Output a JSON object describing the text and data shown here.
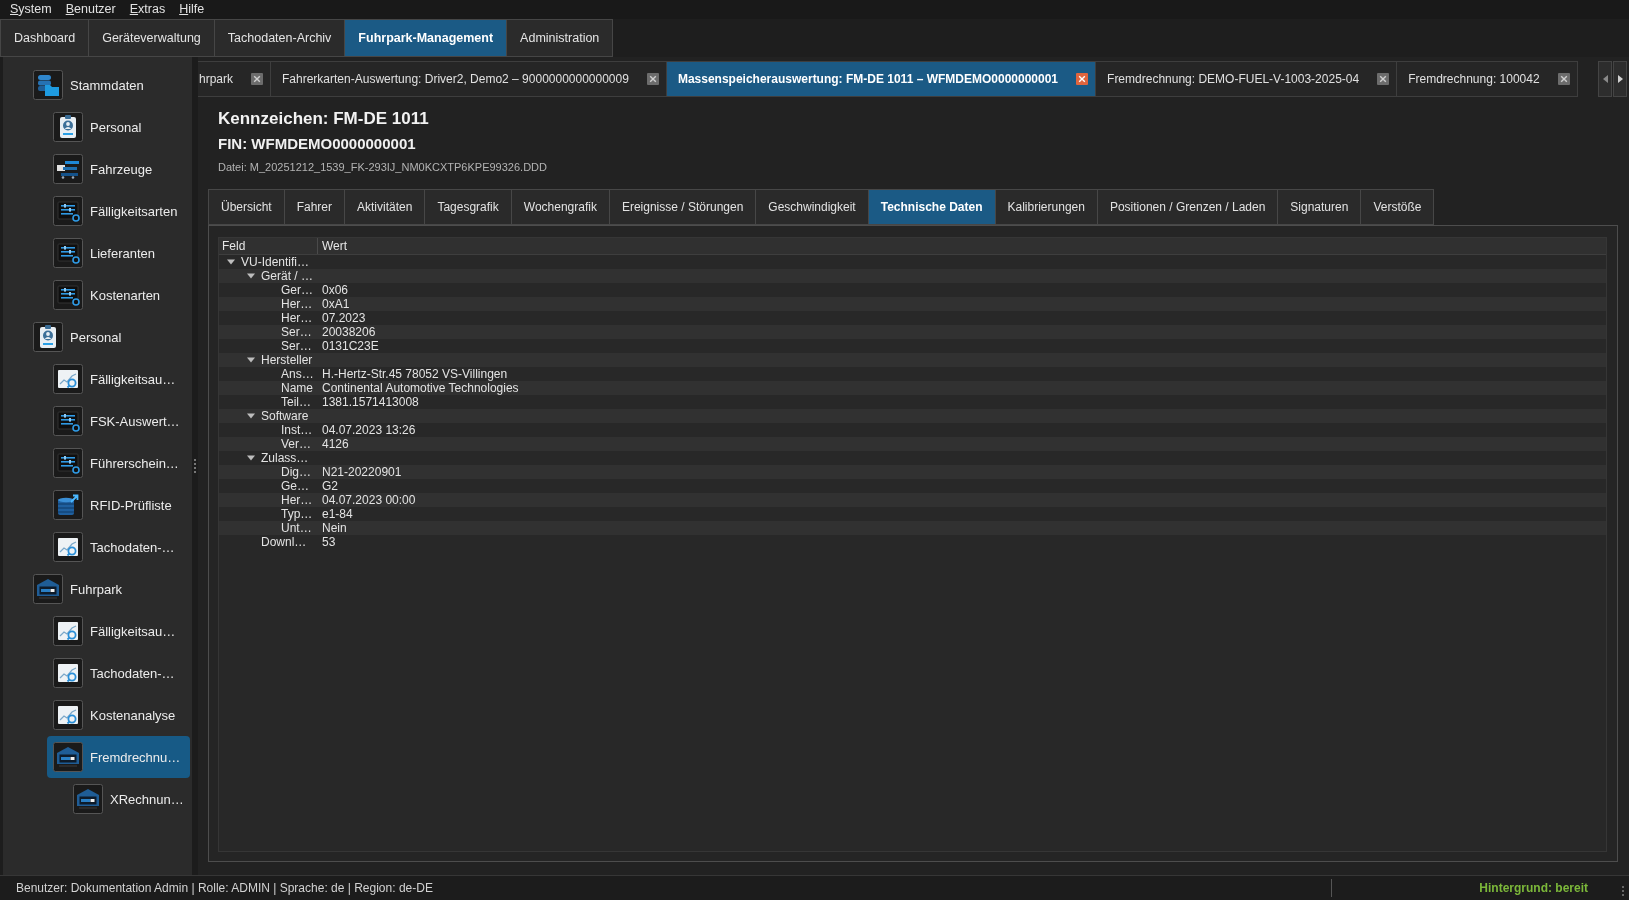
{
  "menu_bar": [
    "System",
    "Benutzer",
    "Extras",
    "Hilfe"
  ],
  "main_tabs": [
    {
      "label": "Dashboard",
      "selected": false
    },
    {
      "label": "Geräteverwaltung",
      "selected": false
    },
    {
      "label": "Tachodaten-Archiv",
      "selected": false
    },
    {
      "label": "Fuhrpark-Management",
      "selected": true
    },
    {
      "label": "Administration",
      "selected": false
    }
  ],
  "sidebar": {
    "items": [
      {
        "label": "Stammdaten",
        "kind": "database",
        "selected": false,
        "children": [
          {
            "label": "Personal",
            "kind": "badge",
            "selected": false
          },
          {
            "label": "Fahrzeuge",
            "kind": "vehicles",
            "selected": false
          },
          {
            "label": "Fälligkeitsarten",
            "kind": "list",
            "selected": false
          },
          {
            "label": "Lieferanten",
            "kind": "list",
            "selected": false
          },
          {
            "label": "Kostenarten",
            "kind": "list",
            "selected": false
          }
        ]
      },
      {
        "label": "Personal",
        "kind": "badge",
        "selected": false,
        "children": [
          {
            "label": "Fälligkeitsau…",
            "kind": "chart",
            "selected": false
          },
          {
            "label": "FSK-Auswert…",
            "kind": "list",
            "selected": false
          },
          {
            "label": "Führerschein…",
            "kind": "list",
            "selected": false
          },
          {
            "label": "RFID-Prüfliste",
            "kind": "export",
            "selected": false
          },
          {
            "label": "Tachodaten-…",
            "kind": "chart",
            "selected": false
          }
        ]
      },
      {
        "label": "Fuhrpark",
        "kind": "depot",
        "selected": false,
        "children": [
          {
            "label": "Fälligkeitsau…",
            "kind": "chart",
            "selected": false
          },
          {
            "label": "Tachodaten-…",
            "kind": "chart",
            "selected": false
          },
          {
            "label": "Kostenanalyse",
            "kind": "chart",
            "selected": false
          },
          {
            "label": "Fremdrechnu…",
            "kind": "depot",
            "selected": true,
            "children": [
              {
                "label": "XRechnun…",
                "kind": "depot",
                "selected": false
              }
            ]
          }
        ]
      }
    ]
  },
  "document_tabs": [
    {
      "label": "hrpark",
      "selected": false
    },
    {
      "label": "Fahrerkarten-Auswertung: Driver2, Demo2 – 9000000000000009",
      "selected": false
    },
    {
      "label": "Massenspeicherauswertung: FM-DE 1011 – WFMDEMO0000000001",
      "selected": true
    },
    {
      "label": "Fremdrechnung: DEMO-FUEL-V-1003-2025-04",
      "selected": false
    },
    {
      "label": "Fremdrechnung: 100042",
      "selected": false
    }
  ],
  "record": {
    "title": "Kennzeichen: FM-DE 1011",
    "subtitle": "FIN: WFMDEMO0000000001",
    "file": "Datei: M_20251212_1539_FK-293IJ_NM0KCXTP6KPE99326.DDD"
  },
  "detail_tabs": [
    {
      "label": "Übersicht",
      "selected": false
    },
    {
      "label": "Fahrer",
      "selected": false
    },
    {
      "label": "Aktivitäten",
      "selected": false
    },
    {
      "label": "Tagesgrafik",
      "selected": false
    },
    {
      "label": "Wochengrafik",
      "selected": false
    },
    {
      "label": "Ereignisse / Störungen",
      "selected": false
    },
    {
      "label": "Geschwindigkeit",
      "selected": false
    },
    {
      "label": "Technische Daten",
      "selected": true
    },
    {
      "label": "Kalibrierungen",
      "selected": false
    },
    {
      "label": "Positionen / Grenzen / Laden",
      "selected": false
    },
    {
      "label": "Signaturen",
      "selected": false
    },
    {
      "label": "Verstöße",
      "selected": false
    }
  ],
  "tree_table": {
    "columns": [
      "Feld",
      "Wert"
    ],
    "rows": [
      {
        "field": "VU-Identifi…",
        "expanded": true,
        "children": [
          {
            "field": "Gerät / …",
            "expanded": true,
            "children": [
              {
                "field": "Ger…",
                "value": "0x06"
              },
              {
                "field": "Her…",
                "value": "0xA1"
              },
              {
                "field": "Her…",
                "value": "07.2023"
              },
              {
                "field": "Ser…",
                "value": "20038206"
              },
              {
                "field": "Ser…",
                "value": "0131C23E"
              }
            ]
          },
          {
            "field": "Hersteller",
            "expanded": true,
            "children": [
              {
                "field": "Ans…",
                "value": "H.-Hertz-Str.45 78052 VS-Villingen"
              },
              {
                "field": "Name",
                "value": "Continental Automotive Technologies"
              },
              {
                "field": "Teil…",
                "value": "1381.1571413008"
              }
            ]
          },
          {
            "field": "Software",
            "expanded": true,
            "children": [
              {
                "field": "Inst…",
                "value": "04.07.2023 13:26"
              },
              {
                "field": "Ver…",
                "value": "4126"
              }
            ]
          },
          {
            "field": "Zulass…",
            "expanded": true,
            "children": [
              {
                "field": "Dig…",
                "value": "N21-20220901"
              },
              {
                "field": "Ge…",
                "value": "G2"
              },
              {
                "field": "Her…",
                "value": "04.07.2023 00:00"
              },
              {
                "field": "Typ…",
                "value": "e1-84"
              },
              {
                "field": "Unt…",
                "value": "Nein"
              }
            ]
          },
          {
            "field": "Downl…",
            "value": "53"
          }
        ]
      }
    ]
  },
  "status_bar": {
    "session": "Benutzer: Dokumentation Admin | Rolle: ADMIN | Sprache: de | Region: de-DE",
    "background_status": "Hintergrund: bereit"
  }
}
